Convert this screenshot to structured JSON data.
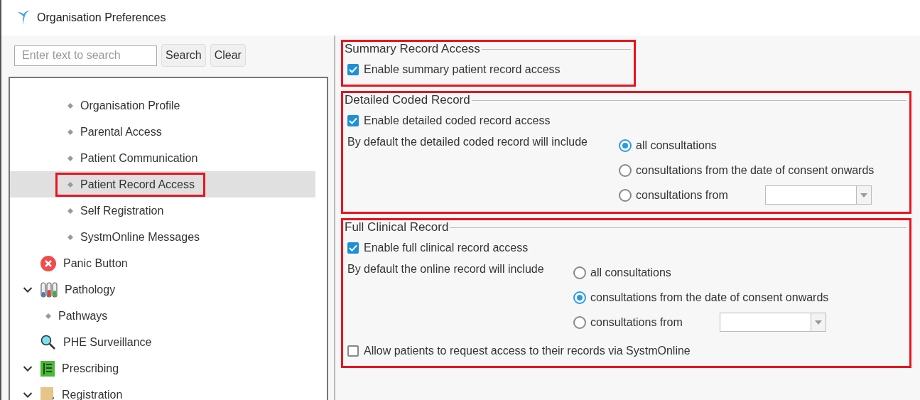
{
  "window": {
    "title": "Organisation Preferences"
  },
  "search": {
    "placeholder": "Enter text to search",
    "buttons": [
      {
        "label": "Search"
      },
      {
        "label": "Clear"
      }
    ]
  },
  "tree": {
    "continued_children": [
      {
        "label": "Organisation Profile",
        "selected": false,
        "highlighted": false
      },
      {
        "label": "Parental Access",
        "selected": false,
        "highlighted": false
      },
      {
        "label": "Patient Communication",
        "selected": false,
        "highlighted": false
      },
      {
        "label": "Patient Record Access",
        "selected": true,
        "highlighted": true
      },
      {
        "label": "Self Registration",
        "selected": false,
        "highlighted": false
      },
      {
        "label": "SystmOnline Messages",
        "selected": false,
        "highlighted": false
      }
    ],
    "items": [
      {
        "label": "Panic Button",
        "kind": "panic",
        "selected": false
      },
      {
        "label": "Pathology",
        "kind": "pathology",
        "selected": false,
        "expanded": true,
        "children": [
          {
            "label": "Pathways",
            "selected": false
          }
        ]
      },
      {
        "label": "PHE Surveillance",
        "kind": "magnifier",
        "selected": false
      },
      {
        "label": "Prescribing",
        "kind": "prescribing",
        "selected": false,
        "expanded": true
      },
      {
        "label": "Registration",
        "kind": "registration",
        "selected": false,
        "expanded": true
      }
    ]
  },
  "sections": [
    {
      "legend": "Summary Record Access",
      "highlighted": true,
      "checkboxes": [
        {
          "label": "Enable summary patient record access",
          "checked": true
        }
      ]
    },
    {
      "legend": "Detailed Coded Record",
      "highlighted": true,
      "checkboxes": [
        {
          "label": "Enable detailed coded record access",
          "checked": true
        }
      ],
      "radio_group": {
        "label": "By default the detailed coded record will include",
        "options": [
          {
            "label": "all consultations",
            "selected": true,
            "kind": "plain"
          },
          {
            "label": "consultations from the date of consent onwards",
            "selected": false,
            "kind": "plain"
          },
          {
            "label": "consultations from",
            "selected": false,
            "kind": "date"
          }
        ]
      }
    },
    {
      "legend": "Full Clinical Record",
      "highlighted": true,
      "checkboxes": [
        {
          "label": "Enable full clinical record access",
          "checked": true
        }
      ],
      "radio_group": {
        "label": "By default the online record will include",
        "options": [
          {
            "label": "all consultations",
            "selected": false,
            "kind": "plain"
          },
          {
            "label": "consultations from the date of consent onwards",
            "selected": true,
            "kind": "plain"
          },
          {
            "label": "consultations from",
            "selected": false,
            "kind": "date"
          }
        ]
      },
      "footer_checkboxes": [
        {
          "label": "Allow patients to request access to their records via SystmOnline",
          "checked": false
        }
      ]
    }
  ]
}
